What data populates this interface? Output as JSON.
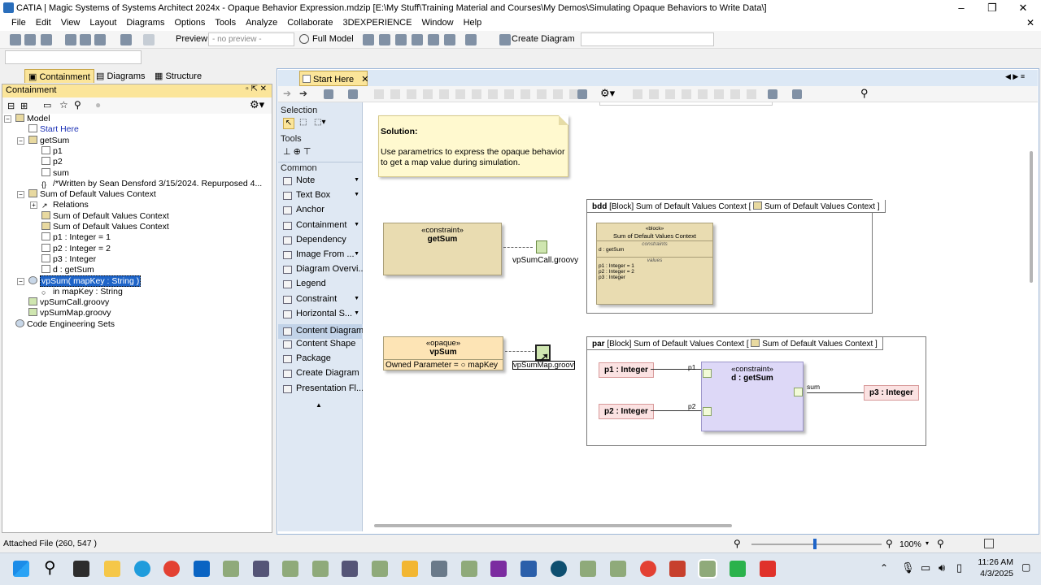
{
  "window": {
    "title": "CATIA | Magic Systems of Systems Architect 2024x - Opaque Behavior Expression.mdzip [E:\\My Stuff\\Training Material and Courses\\My Demos\\Simulating Opaque Behaviors to Write Data\\]",
    "minimize": "–",
    "maximize": "❐",
    "close": "✕",
    "close2": "✕"
  },
  "menu": [
    "File",
    "Edit",
    "View",
    "Layout",
    "Diagrams",
    "Options",
    "Tools",
    "Analyze",
    "Collaborate",
    "3DEXPERIENCE",
    "Window",
    "Help"
  ],
  "toolbar": {
    "preview_label": "Preview:",
    "preview_value": "- no preview -",
    "full_model": "Full Model",
    "create_diagram": "Create Diagram"
  },
  "left_tabs": [
    "Containment",
    "Diagrams",
    "Structure"
  ],
  "containment": {
    "header": "Containment"
  },
  "tree": [
    {
      "label": "Model",
      "level": 0,
      "icon": "pkg",
      "exp": "−"
    },
    {
      "label": "Start Here",
      "level": 1,
      "icon": "doc",
      "link": true
    },
    {
      "label": "getSum",
      "level": 1,
      "icon": "pkg",
      "exp": "−"
    },
    {
      "label": "p1",
      "level": 2,
      "icon": "doc"
    },
    {
      "label": "p2",
      "level": 2,
      "icon": "doc"
    },
    {
      "label": "sum",
      "level": 2,
      "icon": "doc"
    },
    {
      "label": "/*Written by Sean Densford 3/15/2024. Repurposed 4...",
      "level": 2,
      "icon": "none",
      "prefix": "{}"
    },
    {
      "label": "Sum of Default Values Context",
      "level": 1,
      "icon": "pkg",
      "exp": "−"
    },
    {
      "label": "Relations",
      "level": 2,
      "icon": "none",
      "exp": "+",
      "prefix": "↗"
    },
    {
      "label": "Sum of Default Values Context",
      "level": 2,
      "icon": "pkg"
    },
    {
      "label": "Sum of Default Values Context",
      "level": 2,
      "icon": "pkg"
    },
    {
      "label": "p1 : Integer = 1",
      "level": 2,
      "icon": "doc"
    },
    {
      "label": "p2 : Integer = 2",
      "level": 2,
      "icon": "doc"
    },
    {
      "label": "p3 : Integer",
      "level": 2,
      "icon": "doc"
    },
    {
      "label": "d : getSum",
      "level": 2,
      "icon": "doc"
    },
    {
      "label": "vpSum( mapKey : String )",
      "level": 1,
      "icon": "gear",
      "exp": "−",
      "selected": true
    },
    {
      "label": "in mapKey : String",
      "level": 2,
      "icon": "none",
      "prefix": "○"
    },
    {
      "label": "vpSumCall.groovy",
      "level": 1,
      "icon": "file"
    },
    {
      "label": "vpSumMap.groovy",
      "level": 1,
      "icon": "file"
    },
    {
      "label": "Code Engineering Sets",
      "level": 0,
      "icon": "gear"
    }
  ],
  "status": {
    "text": "Attached File (260, 547 )",
    "zoom": "100%"
  },
  "diagram_tab": {
    "label": "Start Here",
    "close": "✕"
  },
  "palette": {
    "selection_head": "Selection",
    "tools_head": "Tools",
    "common_head": "Common",
    "items": [
      {
        "label": "Note",
        "arrow": true
      },
      {
        "label": "Text Box",
        "arrow": true
      },
      {
        "label": "Anchor",
        "arrow": false
      },
      {
        "label": "Containment",
        "arrow": true
      },
      {
        "label": "Dependency",
        "arrow": false
      },
      {
        "label": "Image From ...",
        "arrow": true
      },
      {
        "label": "Diagram Overvi...",
        "arrow": false
      },
      {
        "label": "Legend",
        "arrow": false
      },
      {
        "label": "Constraint",
        "arrow": true
      },
      {
        "label": "Horizontal S...",
        "arrow": true
      }
    ],
    "content_head": "Content Diagram",
    "content_items": [
      "Content Shape",
      "Package",
      "Create Diagram",
      "Presentation Fl..."
    ],
    "more": "▲"
  },
  "note": {
    "title": "Solution:",
    "body": "Use parametrics to express the opaque behavior to get a map value during simulation."
  },
  "constraint_block": {
    "stereotype": "«constraint»",
    "name": "getSum"
  },
  "file1": {
    "label": "vpSumCall.groovy"
  },
  "opaque_block": {
    "stereotype": "«opaque»",
    "name": "vpSum",
    "param": "Owned Parameter = ○ mapKey"
  },
  "file2": {
    "label": "vpSumMap.groovy"
  },
  "bdd": {
    "kind": "bdd",
    "header": "[Block] Sum of Default Values Context [",
    "header2": "Sum of Default Values Context ]",
    "block": {
      "stereotype": "«block»",
      "name": "Sum of Default Values Context",
      "sec1": "constraints",
      "sec1_items": [
        "d : getSum"
      ],
      "sec2": "values",
      "sec2_items": [
        "p1 : Integer = 1",
        "p2 : Integer = 2",
        "p3 : Integer"
      ]
    }
  },
  "par": {
    "kind": "par",
    "header": "[Block] Sum of Default Values Context [",
    "header2": "Sum of Default Values Context ]",
    "p1": "p1 : Integer",
    "p2": "p2 : Integer",
    "p3": "p3 : Integer",
    "prop_stereotype": "«constraint»",
    "prop_name": "d : getSum",
    "port_p1": "p1",
    "port_p2": "p2",
    "port_sum": "sum"
  },
  "clock": {
    "time": "11:26 AM",
    "date": "4/3/2025"
  },
  "colors": {
    "accent": "#fbe59a",
    "selection": "#1e64c8",
    "constraint": "#e9dcb1",
    "opaque": "#fde4b5",
    "par_prop": "#ddd8f7"
  }
}
